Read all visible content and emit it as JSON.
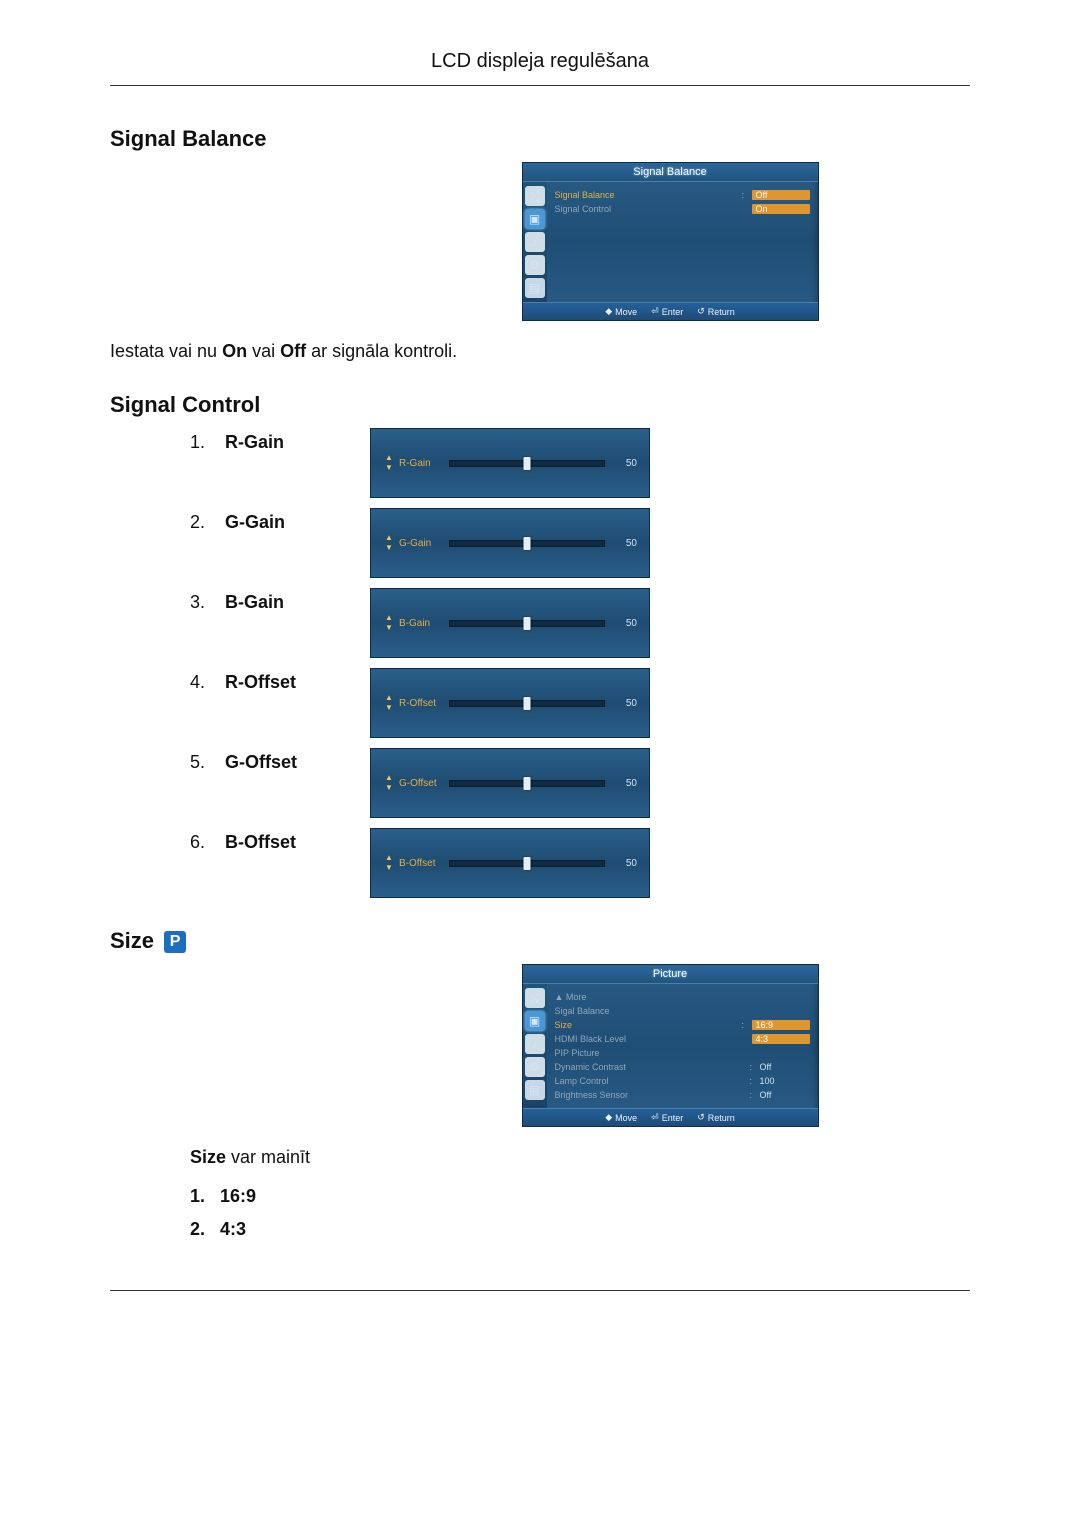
{
  "header": {
    "title": "LCD displeja regulēšana"
  },
  "sections": {
    "signal_balance": {
      "heading": "Signal Balance",
      "description_pre": "Iestata vai nu ",
      "description_on": "On",
      "description_mid": " vai ",
      "description_off": "Off",
      "description_post": " ar signāla kontroli.",
      "osd": {
        "title": "Signal Balance",
        "items": [
          {
            "label": "Signal Balance",
            "opt_off": "Off",
            "opt_on": "On"
          },
          {
            "label": "Signal Control"
          }
        ],
        "footer": {
          "move": "Move",
          "enter": "Enter",
          "return": "Return"
        }
      }
    },
    "signal_control": {
      "heading": "Signal Control",
      "items": [
        {
          "num": "1.",
          "name": "R-Gain",
          "slider_label": "R-Gain",
          "value": "50"
        },
        {
          "num": "2.",
          "name": "G-Gain",
          "slider_label": "G-Gain",
          "value": "50"
        },
        {
          "num": "3.",
          "name": "B-Gain",
          "slider_label": "B-Gain",
          "value": "50"
        },
        {
          "num": "4.",
          "name": "R-Offset",
          "slider_label": "R-Offset",
          "value": "50"
        },
        {
          "num": "5.",
          "name": "G-Offset",
          "slider_label": "G-Offset",
          "value": "50"
        },
        {
          "num": "6.",
          "name": "B-Offset",
          "slider_label": "B-Offset",
          "value": "50"
        }
      ]
    },
    "size": {
      "heading": "Size ",
      "badge": "P",
      "osd": {
        "title": "Picture",
        "items": {
          "more": "▲ More",
          "sigal_balance": "Sigal Balance",
          "size_label": "Size",
          "size_sel": "16:9",
          "size_alt": "4:3",
          "hdmi": "HDMI Black Level",
          "pip": "PIP Picture",
          "dyn_label": "Dynamic Contrast",
          "dyn_val": "Off",
          "lamp_label": "Lamp Control",
          "lamp_val": "100",
          "bright_label": "Brightness Sensor",
          "bright_val": "Off"
        },
        "footer": {
          "move": "Move",
          "enter": "Enter",
          "return": "Return"
        }
      },
      "desc_bold": "Size",
      "desc_rest": " var mainīt",
      "list": [
        {
          "num": "1.",
          "val": "16:9"
        },
        {
          "num": "2.",
          "val": "4:3"
        }
      ]
    }
  }
}
